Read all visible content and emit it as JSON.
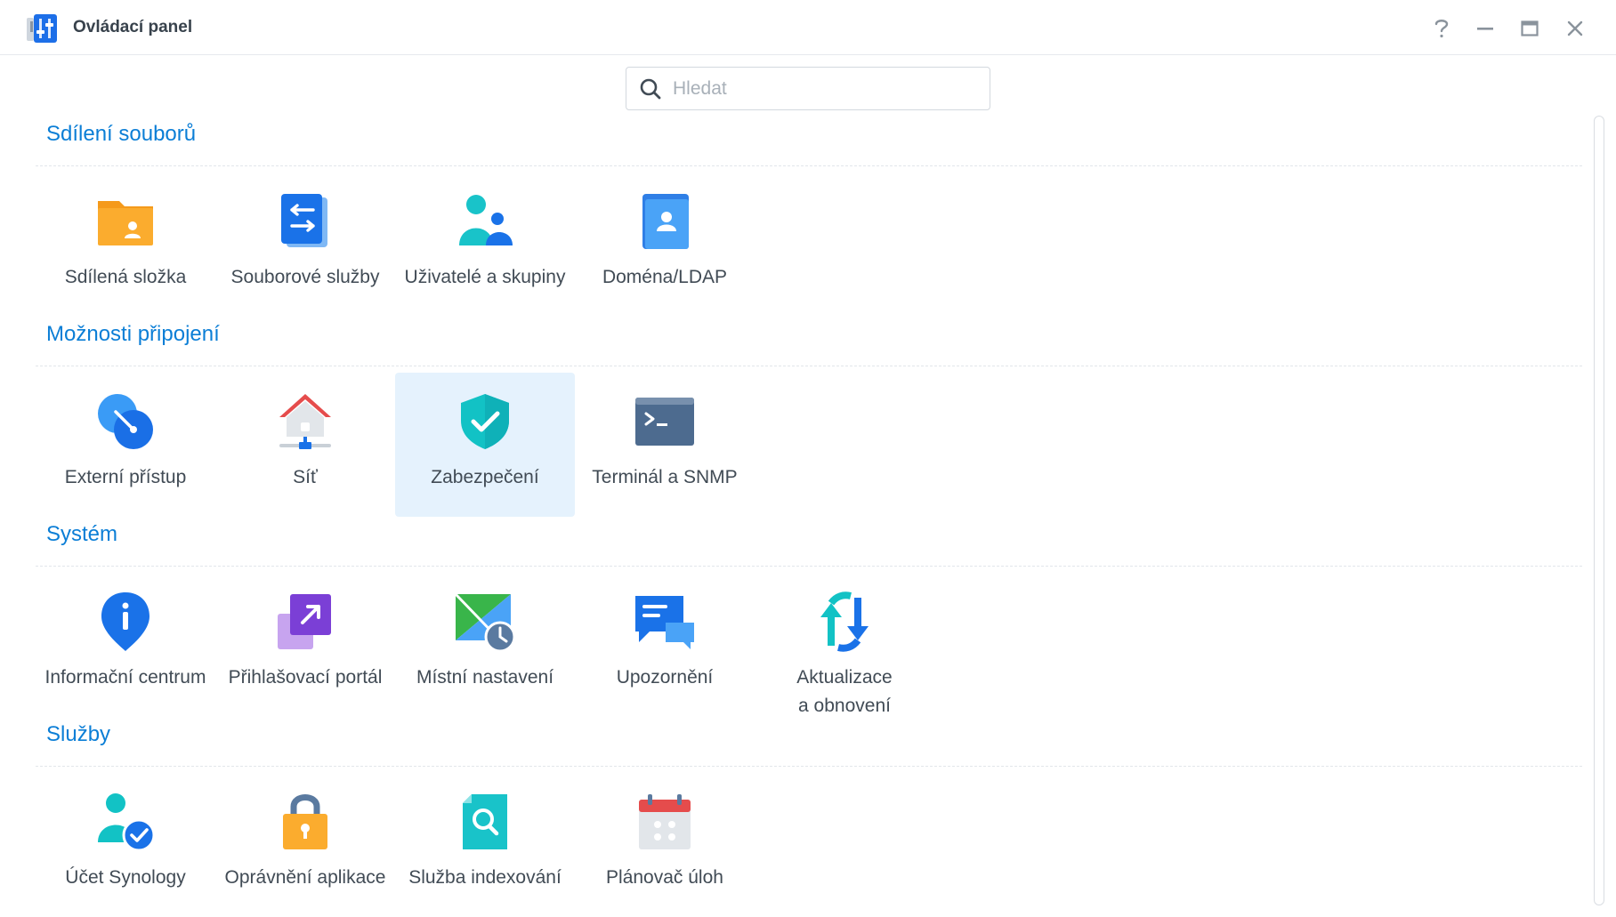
{
  "window": {
    "title": "Ovládací panel"
  },
  "search": {
    "placeholder": "Hledat",
    "value": ""
  },
  "sections": [
    {
      "title": "Sdílení souborů",
      "items": [
        {
          "label": "Sdílená složka",
          "icon": "shared-folder-icon"
        },
        {
          "label": "Souborové služby",
          "icon": "file-services-icon"
        },
        {
          "label": "Uživatelé a skupiny",
          "icon": "users-groups-icon"
        },
        {
          "label": "Doména/LDAP",
          "icon": "domain-ldap-icon"
        }
      ]
    },
    {
      "title": "Možnosti připojení",
      "items": [
        {
          "label": "Externí přístup",
          "icon": "external-access-icon"
        },
        {
          "label": "Síť",
          "icon": "network-icon"
        },
        {
          "label": "Zabezpečení",
          "icon": "security-shield-icon",
          "selected": true
        },
        {
          "label": "Terminál a SNMP",
          "icon": "terminal-icon"
        }
      ]
    },
    {
      "title": "Systém",
      "items": [
        {
          "label": "Informační centrum",
          "icon": "info-center-icon"
        },
        {
          "label": "Přihlašovací portál",
          "icon": "login-portal-icon"
        },
        {
          "label": "Místní nastavení",
          "icon": "regional-options-icon"
        },
        {
          "label": "Upozornění",
          "icon": "notification-icon"
        },
        {
          "label": "Aktualizace",
          "label2": "a obnovení",
          "icon": "update-restore-icon"
        }
      ]
    },
    {
      "title": "Služby",
      "items": [
        {
          "label": "Účet Synology",
          "icon": "synology-account-icon"
        },
        {
          "label": "Oprávnění aplikace",
          "icon": "app-privileges-icon"
        },
        {
          "label": "Služba indexování",
          "icon": "indexing-service-icon"
        },
        {
          "label": "Plánovač úloh",
          "icon": "task-scheduler-icon"
        }
      ]
    }
  ],
  "colors": {
    "section_title": "#0b7ed6",
    "selected_bg": "#e5f2fd",
    "text": "#414b55"
  }
}
